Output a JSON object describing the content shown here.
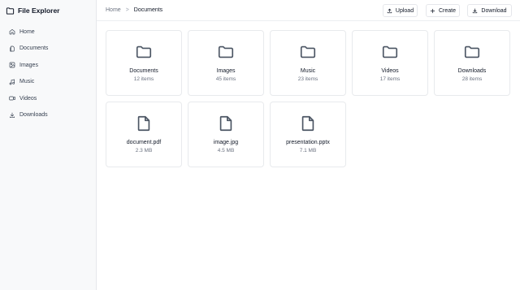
{
  "app": {
    "title": "File Explorer"
  },
  "sidebar": {
    "items": [
      {
        "label": "Home",
        "icon": "home-icon"
      },
      {
        "label": "Documents",
        "icon": "document-icon"
      },
      {
        "label": "Images",
        "icon": "image-icon"
      },
      {
        "label": "Music",
        "icon": "music-icon"
      },
      {
        "label": "Videos",
        "icon": "video-icon"
      },
      {
        "label": "Downloads",
        "icon": "download-icon"
      }
    ]
  },
  "header": {
    "breadcrumb": {
      "root": "Home",
      "separator": ">",
      "current": "Documents"
    },
    "buttons": {
      "upload": "Upload",
      "create": "Create",
      "download": "Download"
    }
  },
  "folders": [
    {
      "name": "Documents",
      "meta": "12 items"
    },
    {
      "name": "Images",
      "meta": "45 items"
    },
    {
      "name": "Music",
      "meta": "23 items"
    },
    {
      "name": "Videos",
      "meta": "17 items"
    },
    {
      "name": "Downloads",
      "meta": "28 items"
    }
  ],
  "files": [
    {
      "name": "document.pdf",
      "meta": "2.3 MB"
    },
    {
      "name": "image.jpg",
      "meta": "4.5 MB"
    },
    {
      "name": "presentation.pptx",
      "meta": "7.1 MB"
    }
  ]
}
